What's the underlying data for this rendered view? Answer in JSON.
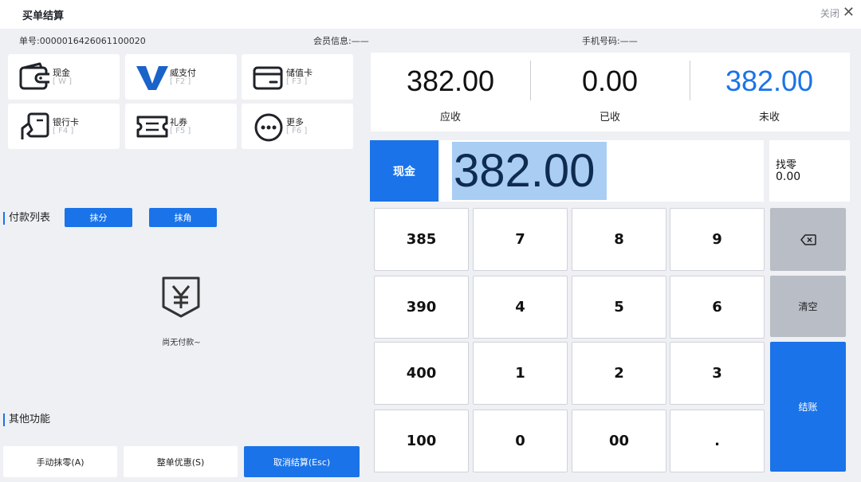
{
  "window": {
    "title": "买单结算",
    "close_label": "关闭",
    "close_icon": "close-icon"
  },
  "info": {
    "order_label": "单号:",
    "order_no": "0000016426061100020",
    "member_label": "会员信息:",
    "member_value": "——",
    "phone_label": "手机号码:",
    "phone_value": "——"
  },
  "payment_methods": [
    {
      "name": "现金",
      "key": "[ W ]",
      "icon": "wallet-icon"
    },
    {
      "name": "威支付",
      "key": "[ F2 ]",
      "icon": "v-pay-icon"
    },
    {
      "name": "储值卡",
      "key": "[ F3 ]",
      "icon": "stored-card-icon"
    },
    {
      "name": "银行卡",
      "key": "[ F4 ]",
      "icon": "bank-card-icon"
    },
    {
      "name": "礼券",
      "key": "[ F5 ]",
      "icon": "coupon-icon"
    },
    {
      "name": "更多",
      "key": "[ F6 ]",
      "icon": "more-icon"
    }
  ],
  "summary": {
    "receivable_value": "382.00",
    "receivable_label": "应收",
    "received_value": "0.00",
    "received_label": "已收",
    "unpaid_value": "382.00",
    "unpaid_label": "未收",
    "unpaid_color": "#1a73e8"
  },
  "entry": {
    "method_label": "现金",
    "amount": "382.00",
    "change_label": "找零",
    "change_value": "0.00"
  },
  "payment_list": {
    "label": "付款列表",
    "round_fen_label": "抹分",
    "round_jiao_label": "抹角",
    "empty_text": "尚无付款~",
    "empty_icon": "yuan-receipt-icon"
  },
  "keypad": {
    "quick": [
      "385",
      "390",
      "400",
      "100"
    ],
    "row1": [
      "7",
      "8",
      "9"
    ],
    "row2": [
      "4",
      "5",
      "6"
    ],
    "row3": [
      "1",
      "2",
      "3"
    ],
    "row4": [
      "0",
      "00",
      "."
    ],
    "backspace_icon": "backspace-icon",
    "clear_label": "清空",
    "checkout_label": "结账"
  },
  "other": {
    "label": "其他功能",
    "manual_round_label": "手动抹零(A)",
    "order_discount_label": "整单优惠(S)",
    "cancel_label": "取消结算(Esc)"
  },
  "colors": {
    "accent": "#1a73e8",
    "selection": "#a9cdf3",
    "gray_key": "#b8bdc6"
  }
}
